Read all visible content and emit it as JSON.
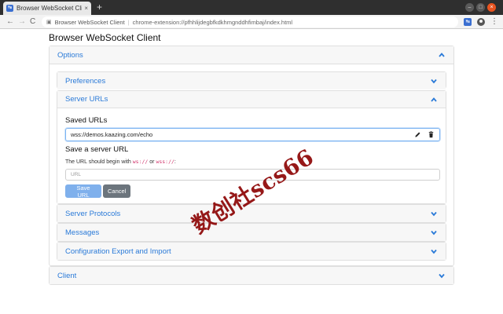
{
  "browser": {
    "tab_title": "Browser WebSocket Client",
    "tab_close": "×",
    "new_tab": "+",
    "omnibox_site": "Browser WebSocket Client",
    "omnibox_url": "chrome-extension://pfhhlijdegbfkdkhmgnddhfimbaj/index.html",
    "buttons": {
      "back": "←",
      "forward": "→",
      "reload": "C",
      "star": "☆",
      "menu": "⋮",
      "minimize": "–",
      "maximize": "□",
      "close": "×"
    }
  },
  "app": {
    "title": "Browser WebSocket Client"
  },
  "options": {
    "label": "Options",
    "sections": {
      "preferences": "Preferences",
      "server_urls": "Server URLs",
      "server_protocols": "Server Protocols",
      "messages": "Messages",
      "config": "Configuration Export and Import"
    }
  },
  "server_urls": {
    "saved_label": "Saved URLs",
    "saved_items": [
      "wss://demos.kaazing.com/echo"
    ],
    "save_heading": "Save a server URL",
    "hint_prefix": "The URL should begin with ",
    "hint_ws": "ws://",
    "hint_or": " or ",
    "hint_wss": "wss://",
    "hint_suffix": ":",
    "input_placeholder": "URL",
    "save_button": "Save URL",
    "cancel_button": "Cancel"
  },
  "client": {
    "label": "Client"
  },
  "watermark": "数创社scs66",
  "colors": {
    "link_blue": "#2a7ad8",
    "save_button": "#7fb0ec",
    "cancel_button": "#6c757d",
    "accent_border": "#7ab3f2"
  },
  "icons": {
    "edit": "pencil-icon",
    "delete": "trash-icon",
    "chevron_up": "chevron-up-icon",
    "chevron_down": "chevron-down-icon"
  }
}
